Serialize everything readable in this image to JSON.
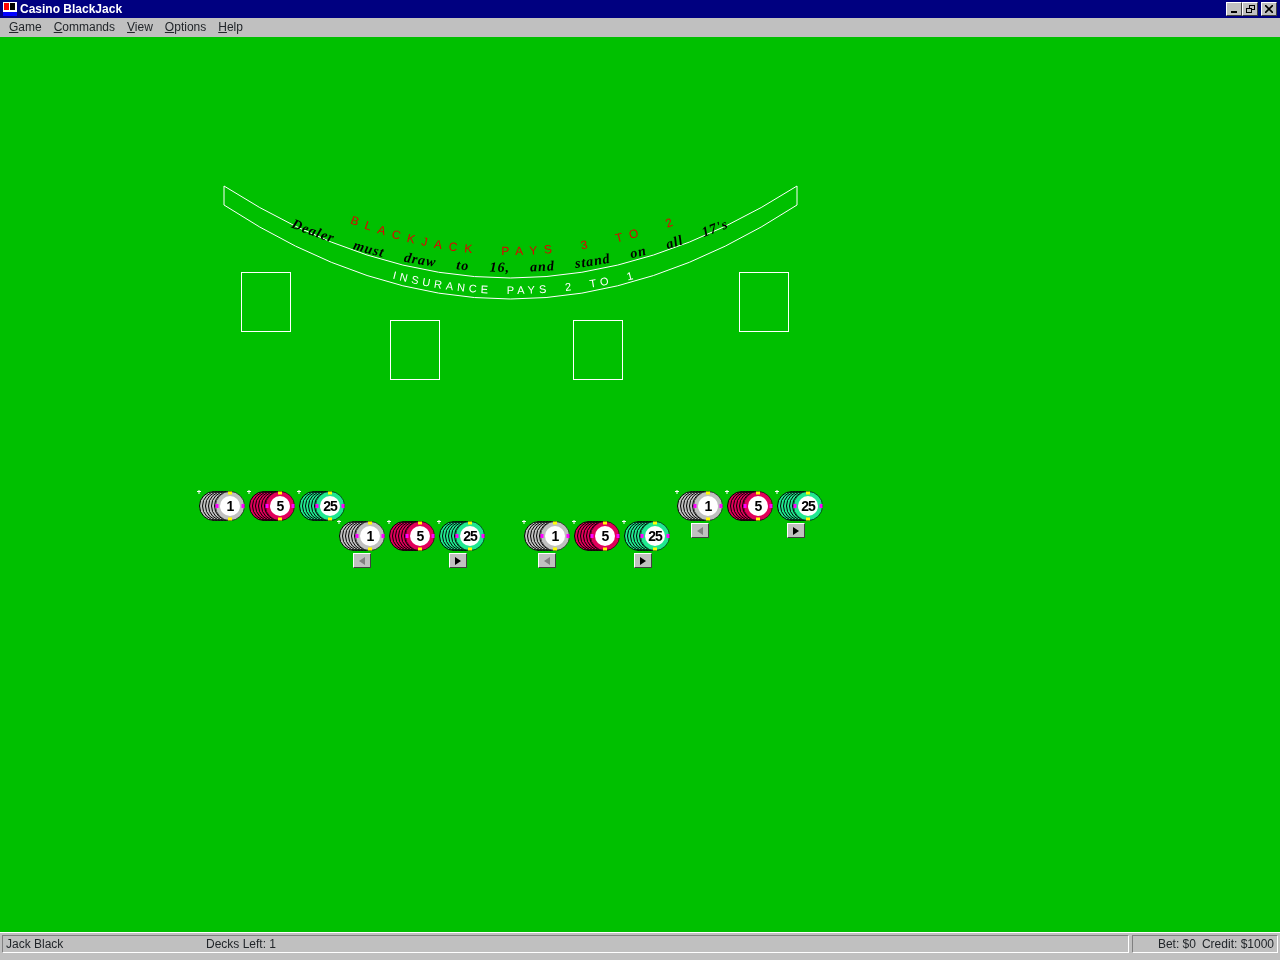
{
  "window": {
    "title": "Casino BlackJack"
  },
  "menu": [
    {
      "label": "Game"
    },
    {
      "label": "Commands"
    },
    {
      "label": "View"
    },
    {
      "label": "Options"
    },
    {
      "label": "Help"
    }
  ],
  "table": {
    "blackjack_rule": [
      "BLACKJACK",
      "PAYS",
      "3",
      "TO",
      "2"
    ],
    "dealer_rule": [
      "Dealer",
      "must",
      "draw",
      "to",
      "16,",
      "and",
      "stand",
      "on",
      "all",
      "17's"
    ],
    "insurance_rule": [
      "INSURANCE",
      "PAYS",
      "2",
      "TO",
      "1"
    ]
  },
  "seats": [
    {
      "chips": [
        {
          "value": "1",
          "color": "#c0c0c0"
        },
        {
          "value": "5",
          "color": "#e0005a"
        },
        {
          "value": "25",
          "color": "#20e890"
        }
      ]
    },
    {
      "chips": [
        {
          "value": "1",
          "color": "#c0c0c0"
        },
        {
          "value": "5",
          "color": "#e0005a"
        },
        {
          "value": "25",
          "color": "#20e890"
        }
      ],
      "left_arrow": {
        "disabled": true
      },
      "right_arrow": {
        "disabled": false
      }
    },
    {
      "chips": [
        {
          "value": "1",
          "color": "#c0c0c0"
        },
        {
          "value": "5",
          "color": "#e0005a"
        },
        {
          "value": "25",
          "color": "#20e890"
        }
      ],
      "left_arrow": {
        "disabled": true
      },
      "right_arrow": {
        "disabled": false
      }
    },
    {
      "chips": [
        {
          "value": "1",
          "color": "#c0c0c0"
        },
        {
          "value": "5",
          "color": "#e0005a"
        },
        {
          "value": "25",
          "color": "#20e890"
        }
      ],
      "left_arrow": {
        "disabled": true
      },
      "right_arrow": {
        "disabled": false
      }
    }
  ],
  "status_bar": {
    "player": "Jack Black",
    "decks_left": "Decks Left: 1",
    "bet": "Bet: $0",
    "credit": "Credit: $1000"
  }
}
